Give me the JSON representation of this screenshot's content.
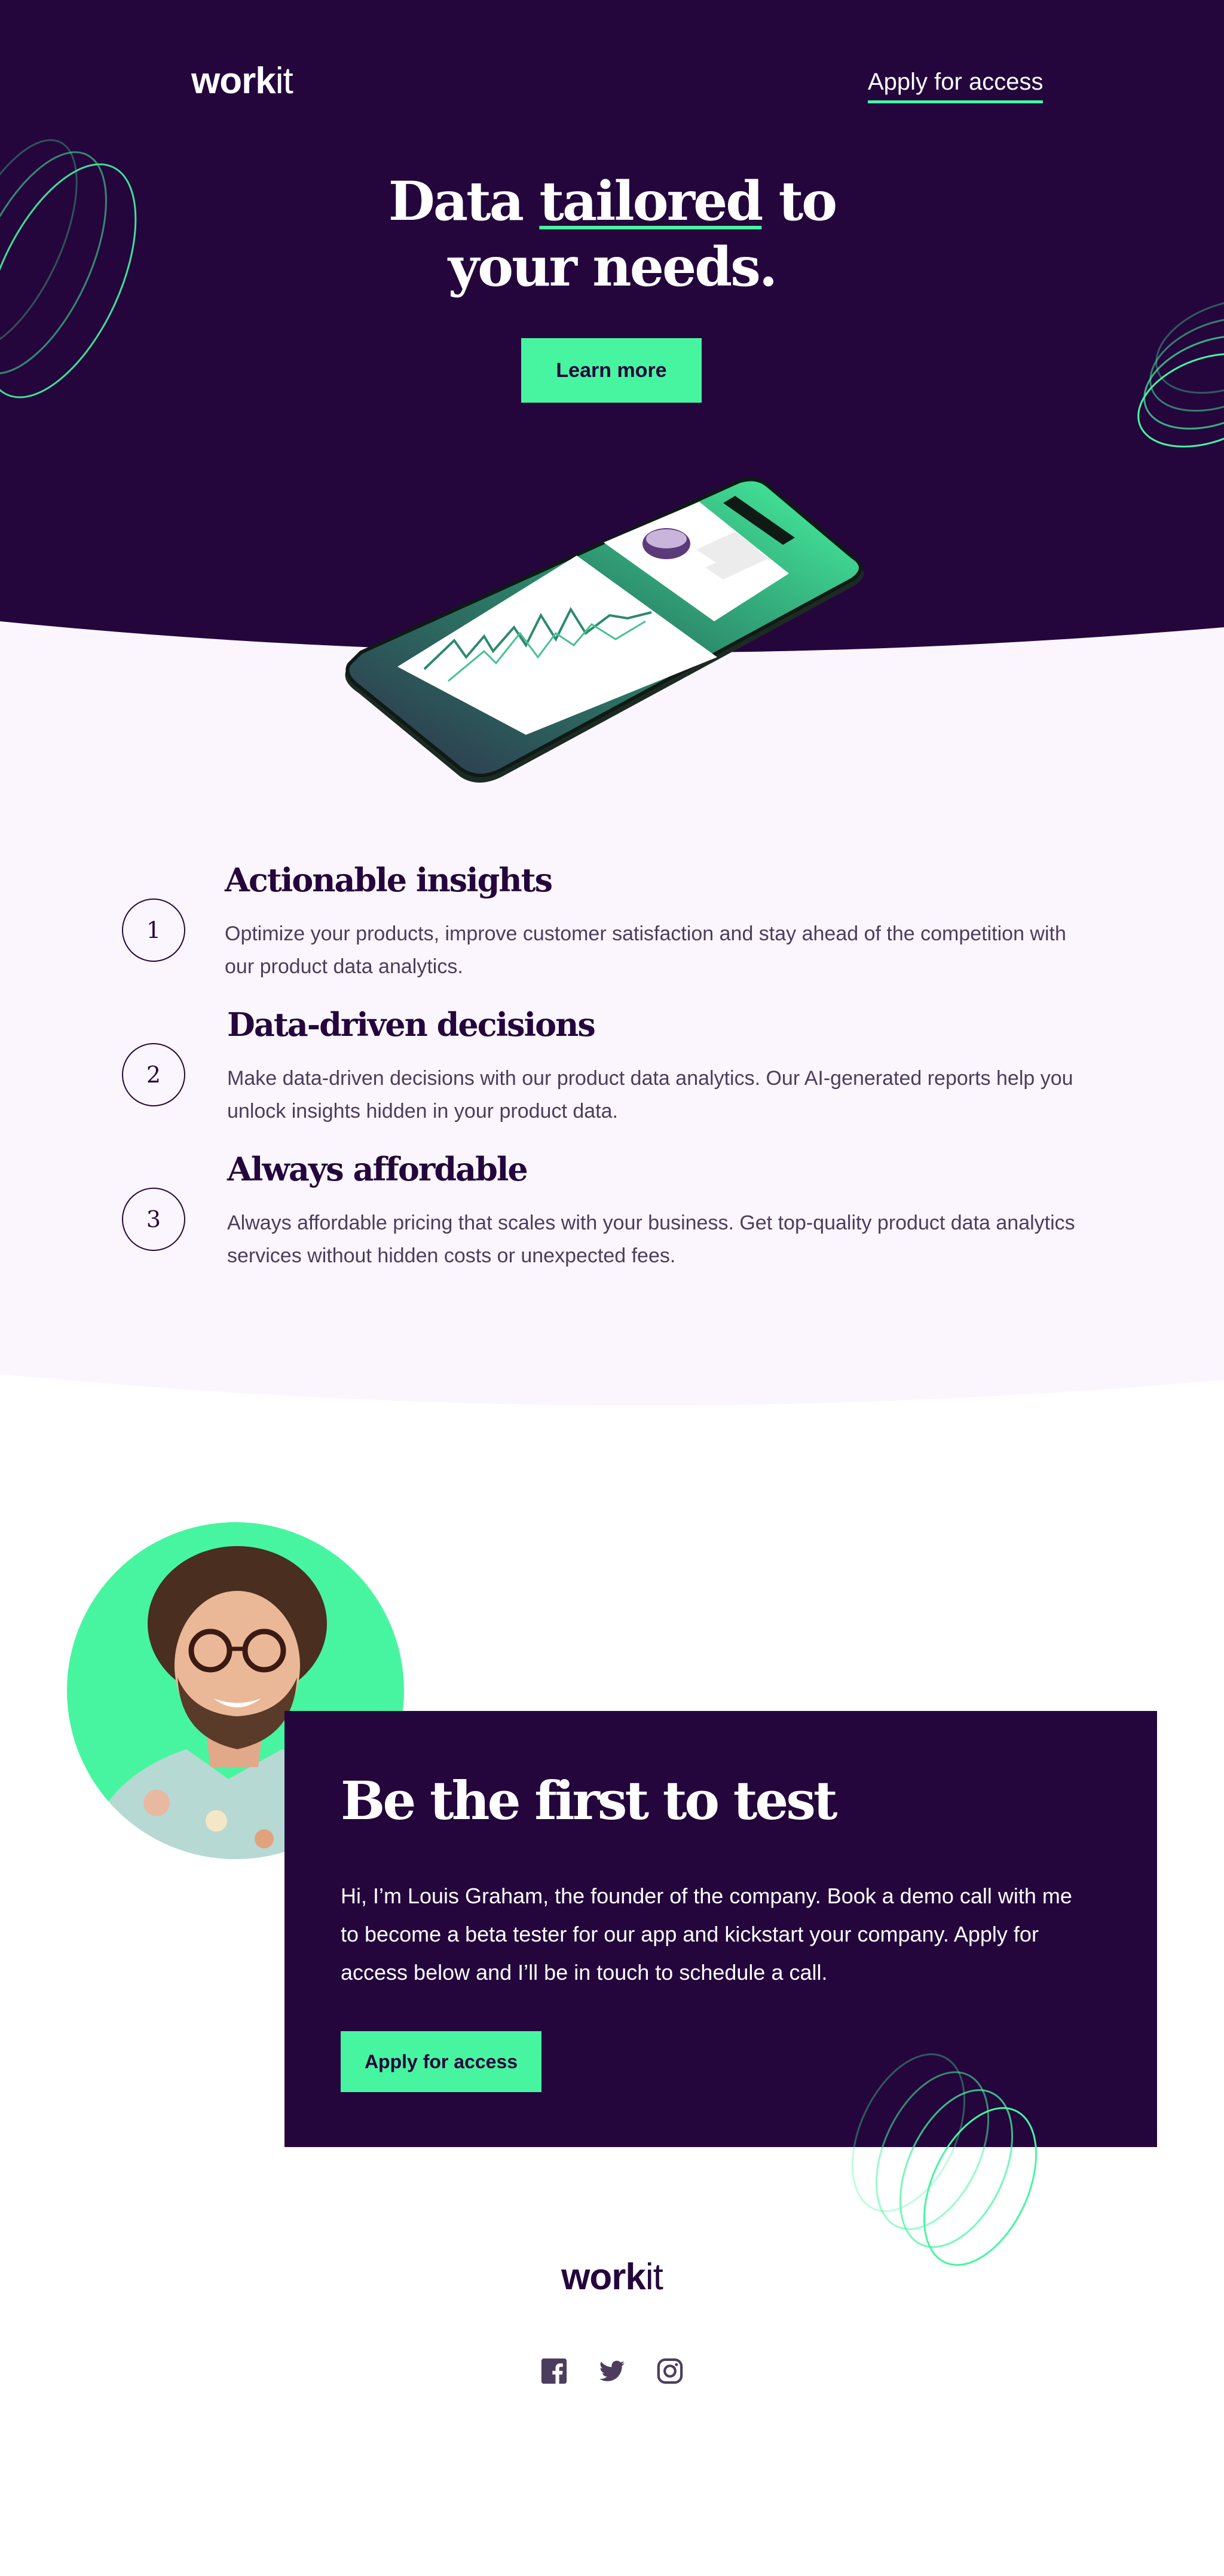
{
  "brand": {
    "logo_bold": "work",
    "logo_light": "it",
    "colors": {
      "dark_purple": "#24063d",
      "mint": "#47f5a0",
      "lavender_bg": "#fbf6fd",
      "body_text": "#4c3d5e"
    }
  },
  "header": {
    "apply_link": "Apply for access"
  },
  "hero": {
    "title_before": "Data ",
    "title_underlined": "tailored",
    "title_after": " to",
    "title_line2": "your needs.",
    "cta_label": "Learn more",
    "phone_image": "smartphone-with-analytics-chart-illustration"
  },
  "features": [
    {
      "number": "1",
      "title": "Actionable insights",
      "text": "Optimize your products, improve customer satisfaction and stay ahead of the competition with our product data analytics."
    },
    {
      "number": "2",
      "title": "Data-driven decisions",
      "text": "Make data-driven decisions with our product data analytics. Our AI-generated reports help you unlock insights hidden in your product data."
    },
    {
      "number": "3",
      "title": "Always affordable",
      "text": "Always affordable pricing that scales with your business. Get top-quality product data analytics services without hidden costs or unexpected fees."
    }
  ],
  "founder": {
    "portrait": "founder-portrait-louis-graham",
    "title": "Be the first to test",
    "text": "Hi, I’m Louis Graham, the founder of the company. Book a demo call with me to become a beta tester for our app and kickstart your company. Apply for access below and I’ll be in touch to schedule a call.",
    "cta_label": "Apply for access"
  },
  "footer": {
    "logo_bold": "work",
    "logo_light": "it",
    "social_icons": [
      "facebook-icon",
      "twitter-icon",
      "instagram-icon"
    ]
  }
}
